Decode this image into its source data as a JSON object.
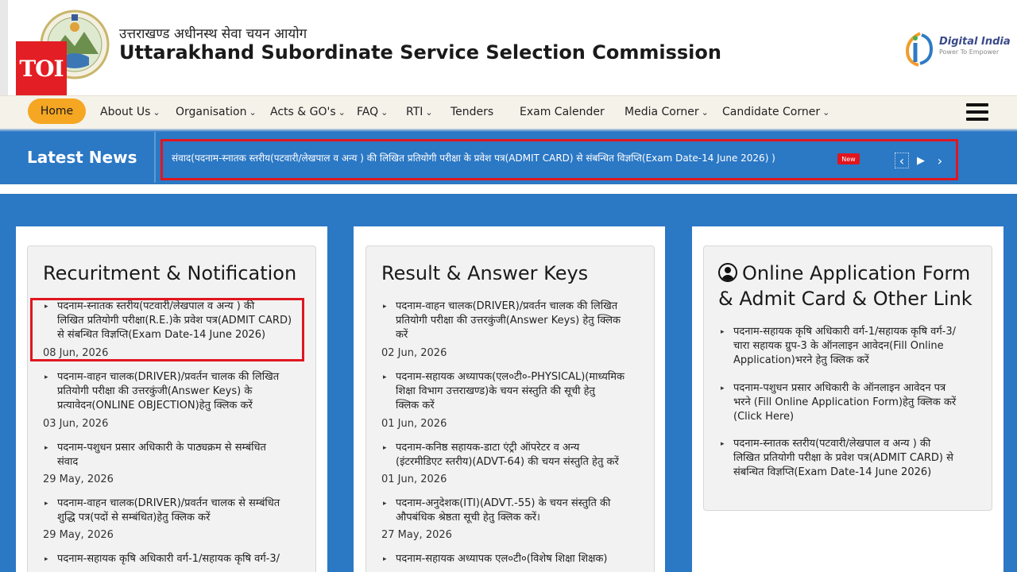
{
  "header": {
    "title_hindi": "उत्तराखण्ड अधीनस्थ सेवा चयन आयोग",
    "title_english": "Uttarakhand Subordinate Service Selection Commission",
    "watermark": "TOI",
    "digital_india": {
      "name": "Digital India",
      "tagline": "Power To Empower"
    }
  },
  "nav": {
    "items": [
      {
        "label": "Home",
        "dropdown": false
      },
      {
        "label": "About Us",
        "dropdown": true
      },
      {
        "label": "Organisation",
        "dropdown": true
      },
      {
        "label": "Acts & GO's",
        "dropdown": true
      },
      {
        "label": "FAQ",
        "dropdown": true
      },
      {
        "label": "RTI",
        "dropdown": true
      },
      {
        "label": "Tenders",
        "dropdown": false
      },
      {
        "label": "Exam Calender",
        "dropdown": false
      },
      {
        "label": "Media Corner",
        "dropdown": true
      },
      {
        "label": "Candidate Corner",
        "dropdown": true
      }
    ],
    "chevron": "⌄"
  },
  "news": {
    "label": "Latest News",
    "text": "संवाद(पदनाम-स्नातक स्तरीय(पटवारी/लेखपाल व अन्य ) की लिखित प्रतियोगी परीक्षा के प्रवेश पत्र(ADMIT CARD) से संबन्धित विज्ञप्ति(Exam Date-14 June 2026) )",
    "badge": "New"
  },
  "recruitment": {
    "title": "Recuritment & Notification",
    "items": [
      {
        "lines": [
          "पदनाम-स्नातक स्तरीय(पटवारी/लेखपाल व अन्य ) की",
          "लिखित प्रतियोगी परीक्षा(R.E.)के प्रवेश पत्र(ADMIT CARD)",
          "से संबन्धित विज्ञप्ति(Exam Date-14 June 2026)"
        ],
        "date": "08 Jun, 2026"
      },
      {
        "lines": [
          "पदनाम-वाहन चालक(DRIVER)/प्रवर्तन चालक की लिखित",
          "प्रतियोगी परीक्षा की उत्तरकुंजी(Answer Keys) के",
          "प्रत्यावेदन(ONLINE OBJECTION)हेतु क्लिक करें"
        ],
        "date": "03 Jun, 2026"
      },
      {
        "lines": [
          "पदनाम-पशुधन प्रसार अधिकारी के पाठ्यक्रम से सम्बंधित",
          "संवाद"
        ],
        "date": "29 May, 2026"
      },
      {
        "lines": [
          "पदनाम-वाहन चालक(DRIVER)/प्रवर्तन चालक से सम्बंधित",
          "शुद्धि पत्र(पदों से सम्बंधित)हेतु क्लिक करें"
        ],
        "date": "29 May, 2026"
      },
      {
        "lines": [
          "पदनाम-सहायक कृषि अधिकारी वर्ग-1/सहायक कृषि वर्ग-3/"
        ],
        "date": ""
      }
    ]
  },
  "results": {
    "title": "Result & Answer Keys",
    "items": [
      {
        "lines": [
          "पदनाम-वाहन चालक(DRIVER)/प्रवर्तन चालक की लिखित",
          "प्रतियोगी परीक्षा की उत्तरकुंजी(Answer Keys) हेतु क्लिक",
          "करें"
        ],
        "date": "02 Jun, 2026"
      },
      {
        "lines": [
          "पदनाम-सहायक अध्यापक(एल०टी०-PHYSICAL)(माध्यमिक",
          "शिक्षा विभाग उत्तराखण्ड)के चयन संस्तुति की सूची हेतु",
          "क्लिक करें"
        ],
        "date": "01 Jun, 2026"
      },
      {
        "lines": [
          "पदनाम-कनिष्ठ सहायक-डाटा एंट्री ऑपरेटर व अन्य",
          "(इंटरमीडिएट स्तरीय)(ADVT-64) की चयन संस्तुति हेतु करें"
        ],
        "date": "01 Jun, 2026"
      },
      {
        "lines": [
          "पदनाम-अनुदेशक(ITI)(ADVT.-55) के चयन संस्तुति की",
          "औपबंधिक श्रेष्ठता सूची हेतु क्लिक करें।"
        ],
        "date": "27 May, 2026"
      },
      {
        "lines": [
          "पदनाम-सहायक अध्यापक एल०टी०(विशेष शिक्षा शिक्षक)"
        ],
        "date": ""
      }
    ]
  },
  "online": {
    "title_line1": "Online Application Form",
    "title_line2": "& Admit Card & Other Link",
    "items": [
      {
        "lines": [
          "पदनाम-सहायक कृषि अधिकारी वर्ग-1/सहायक कृषि वर्ग-3/",
          "चारा सहायक ग्रुप-3 के ऑनलाइन आवेदन(Fill Online",
          "Application)भरने हेतु क्लिक करें"
        ]
      },
      {
        "lines": [
          "पदनाम-पशुधन प्रसार अधिकारी के ऑनलाइन आवेदन पत्र",
          "भरने (Fill Online Application Form)हेतु क्लिक करें",
          "(Click Here)"
        ]
      },
      {
        "lines": [
          "पदनाम-स्नातक स्तरीय(पटवारी/लेखपाल व अन्य ) की",
          "लिखित प्रतियोगी परीक्षा के प्रवेश पत्र(ADMIT CARD) से",
          "संबन्धित विज्ञप्ति(Exam Date-14 June 2026)"
        ]
      }
    ]
  },
  "colors": {
    "primary_blue": "#2b78c5",
    "accent_orange": "#f5a623",
    "highlight_red": "#e0161f"
  }
}
